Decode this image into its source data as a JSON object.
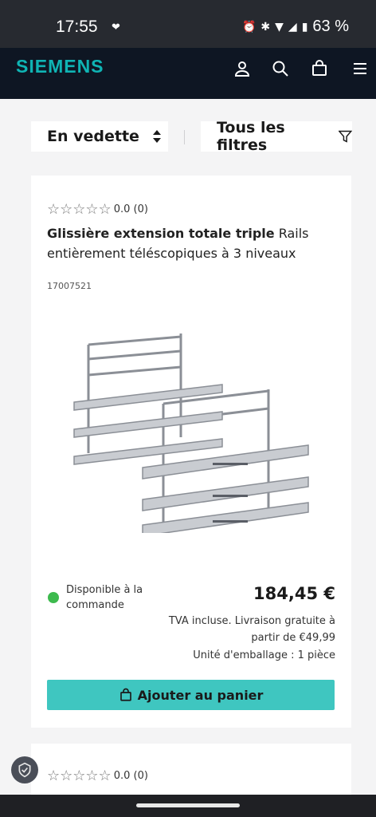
{
  "status_bar": {
    "time": "17:55",
    "battery": "63 %"
  },
  "header": {
    "brand": "SIEMENS"
  },
  "toolbar": {
    "sort_label": "En vedette",
    "filters_label": "Tous les filtres"
  },
  "product": {
    "stars": "☆☆☆☆☆",
    "rating": "0.0 (0)",
    "title_bold": "Glissière extension totale triple",
    "title_rest": " Rails entièrement téléscopiques à 3 niveaux",
    "sku": "17007521",
    "availability": "Disponible à la commande",
    "price": "184,45 €",
    "tax_note": "TVA incluse. Livraison gratuite à partir de €49,99",
    "packaging": "Unité d'emballage : 1 pièce",
    "add_to_cart": "Ajouter au panier"
  },
  "product2": {
    "stars": "☆☆☆☆☆",
    "rating": "0.0 (0)"
  },
  "colors": {
    "accent": "#3fc6c0",
    "brand": "#0fb4b4",
    "available": "#3dba4e",
    "header_bg": "#0e1623"
  }
}
